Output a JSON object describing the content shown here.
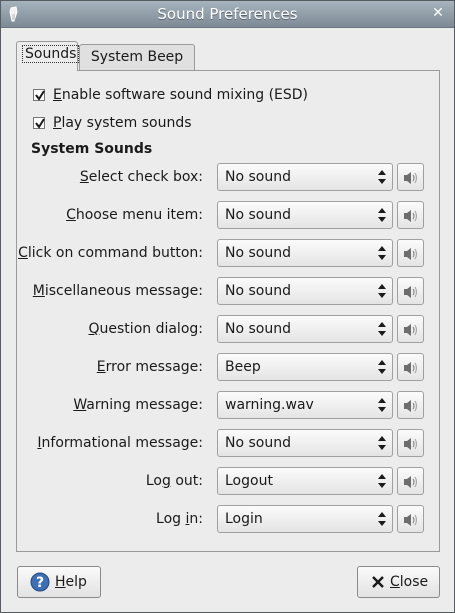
{
  "window": {
    "title": "Sound Preferences",
    "close_glyph": "✕"
  },
  "tabs": [
    {
      "label": "Sounds",
      "active": true
    },
    {
      "label": "System Beep",
      "active": false
    }
  ],
  "options": [
    {
      "mnemonic": "E",
      "rest": "nable software sound mixing (ESD)",
      "checked": true
    },
    {
      "mnemonic": "P",
      "rest": "lay system sounds",
      "checked": true
    }
  ],
  "system_sounds": {
    "heading": "System Sounds",
    "rows": [
      {
        "pre": "",
        "mnemonic": "S",
        "post": "elect check box:",
        "value": "No sound"
      },
      {
        "pre": "",
        "mnemonic": "C",
        "post": "hoose menu item:",
        "value": "No sound"
      },
      {
        "pre": "",
        "mnemonic": "C",
        "post": "lick on command button:",
        "value": "No sound"
      },
      {
        "pre": "",
        "mnemonic": "M",
        "post": "iscellaneous message:",
        "value": "No sound"
      },
      {
        "pre": "",
        "mnemonic": "Q",
        "post": "uestion dialog:",
        "value": "No sound"
      },
      {
        "pre": "",
        "mnemonic": "E",
        "post": "rror message:",
        "value": "Beep"
      },
      {
        "pre": "",
        "mnemonic": "W",
        "post": "arning message:",
        "value": "warning.wav"
      },
      {
        "pre": "",
        "mnemonic": "I",
        "post": "nformational message:",
        "value": "No sound"
      },
      {
        "pre": "Lo",
        "mnemonic": "g",
        "post": " out:",
        "value": "Logout"
      },
      {
        "pre": "Log ",
        "mnemonic": "i",
        "post": "n:",
        "value": "Login"
      }
    ]
  },
  "buttons": {
    "help": {
      "mnemonic": "H",
      "rest": "elp"
    },
    "close": {
      "mnemonic": "C",
      "rest": "lose"
    }
  },
  "icons": {
    "title": "sound-preferences-app-icon",
    "play": "speaker-play-icon",
    "help": "help-icon",
    "close": "close-icon"
  }
}
